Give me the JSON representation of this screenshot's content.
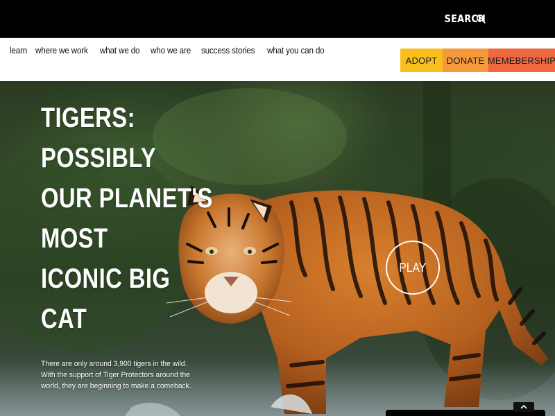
{
  "header": {
    "search_label": "SEARCH",
    "search_icon": "search-icon"
  },
  "nav": {
    "links": [
      "learn",
      "where we work",
      "what we do",
      "who we are",
      "success stories",
      "what you can do"
    ]
  },
  "cta": {
    "adopt": {
      "label": "ADOPT",
      "color": "#f9bf1d"
    },
    "donate": {
      "label": "DONATE",
      "color": "#f5993b"
    },
    "membership": {
      "label": "MEMEBERSHIP",
      "color": "#f0683f"
    }
  },
  "hero": {
    "headline_lines": [
      "TIGERS:",
      "POSSIBLY",
      "OUR PLANET'S",
      "MOST",
      "ICONIC BIG",
      "CAT"
    ],
    "subtext": "There are only around 3,900 tigers in the wild. With the support of Tiger Protectors around the world, they are beginning to make a comeback.",
    "play_label": "PLAY"
  },
  "footer": {
    "back_to_top_icon": "chevron-up-icon"
  }
}
